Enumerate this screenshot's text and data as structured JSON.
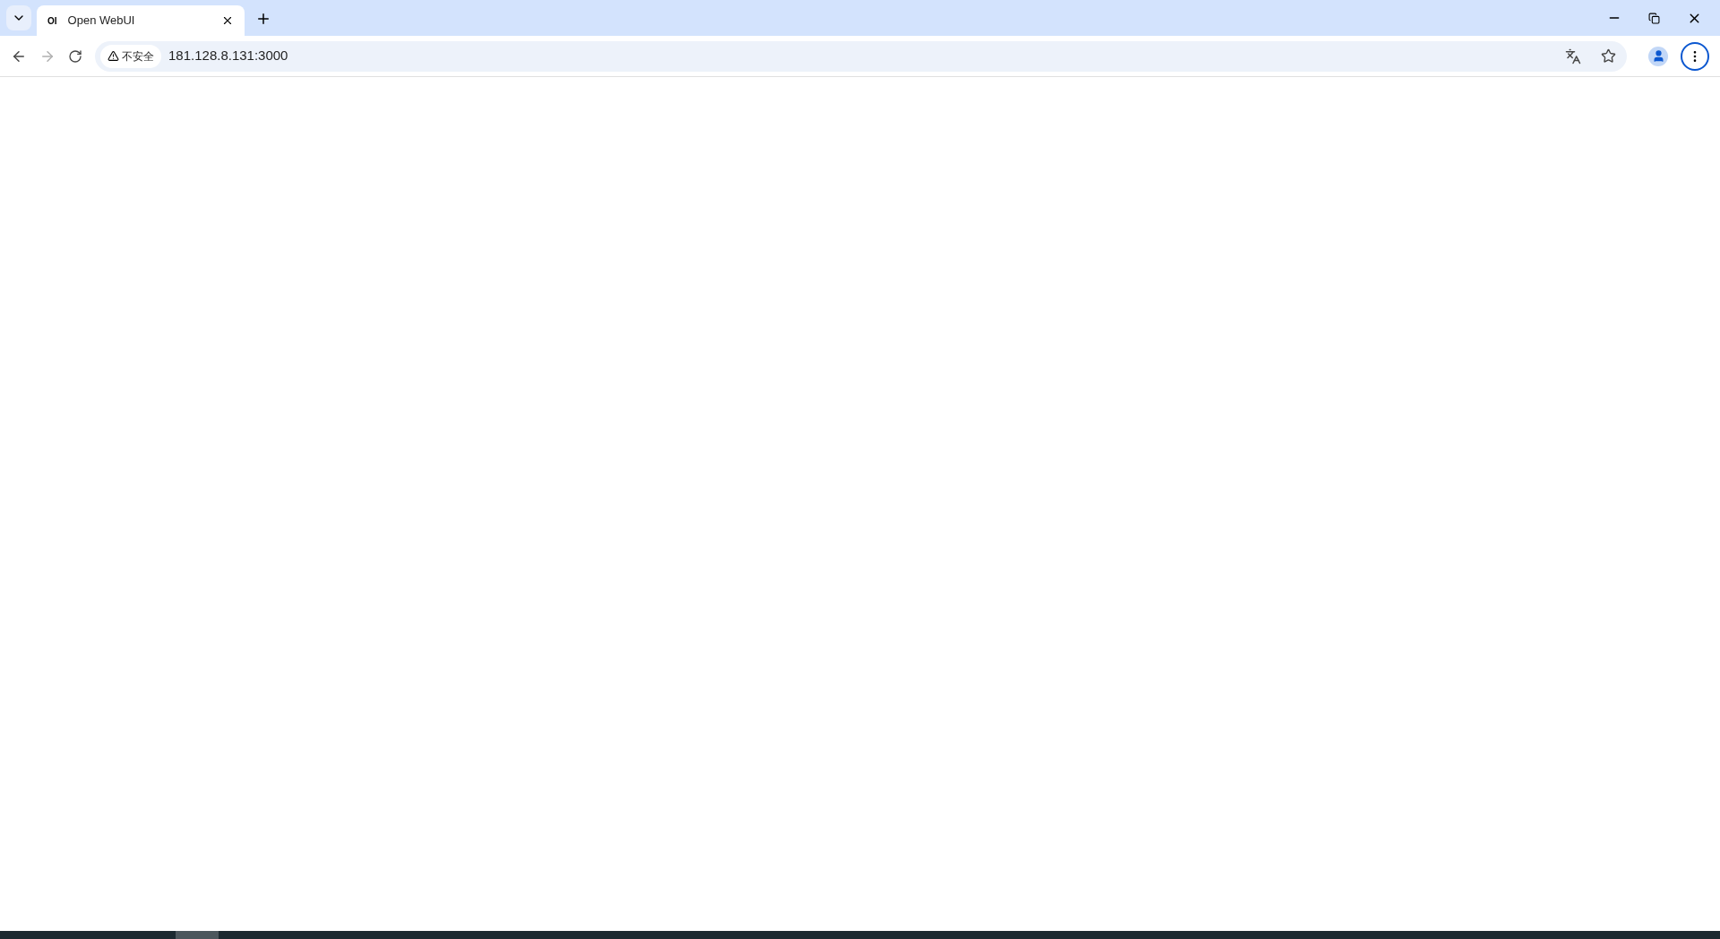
{
  "tab_strip": {
    "tabs": [
      {
        "favicon": "OI",
        "title": "Open WebUI",
        "selected": true
      }
    ]
  },
  "toolbar": {
    "security_label": "不安全",
    "url": "181.128.8.131:3000",
    "forward_disabled": true
  }
}
